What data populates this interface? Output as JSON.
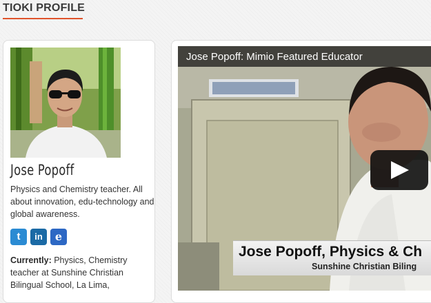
{
  "section": {
    "title": "TIOKI PROFILE"
  },
  "profile": {
    "name": "Jose Popoff",
    "bio": "Physics and Chemistry teacher. All about innovation, edu-technology and global awareness.",
    "currently_label": "Currently:",
    "currently_text": "Physics, Chemistry teacher at Sunshine Christian Bilingual School, La Lima,",
    "social": [
      {
        "icon": "twitter-icon",
        "glyph": "t"
      },
      {
        "icon": "linkedin-icon",
        "glyph": "in"
      },
      {
        "icon": "edmodo-icon",
        "glyph": "e"
      }
    ]
  },
  "video": {
    "title": "Jose Popoff: Mimio Featured Educator",
    "lower_third_name": "Jose Popoff, Physics & Ch",
    "lower_third_sub": "Sunshine Christian Biling"
  }
}
